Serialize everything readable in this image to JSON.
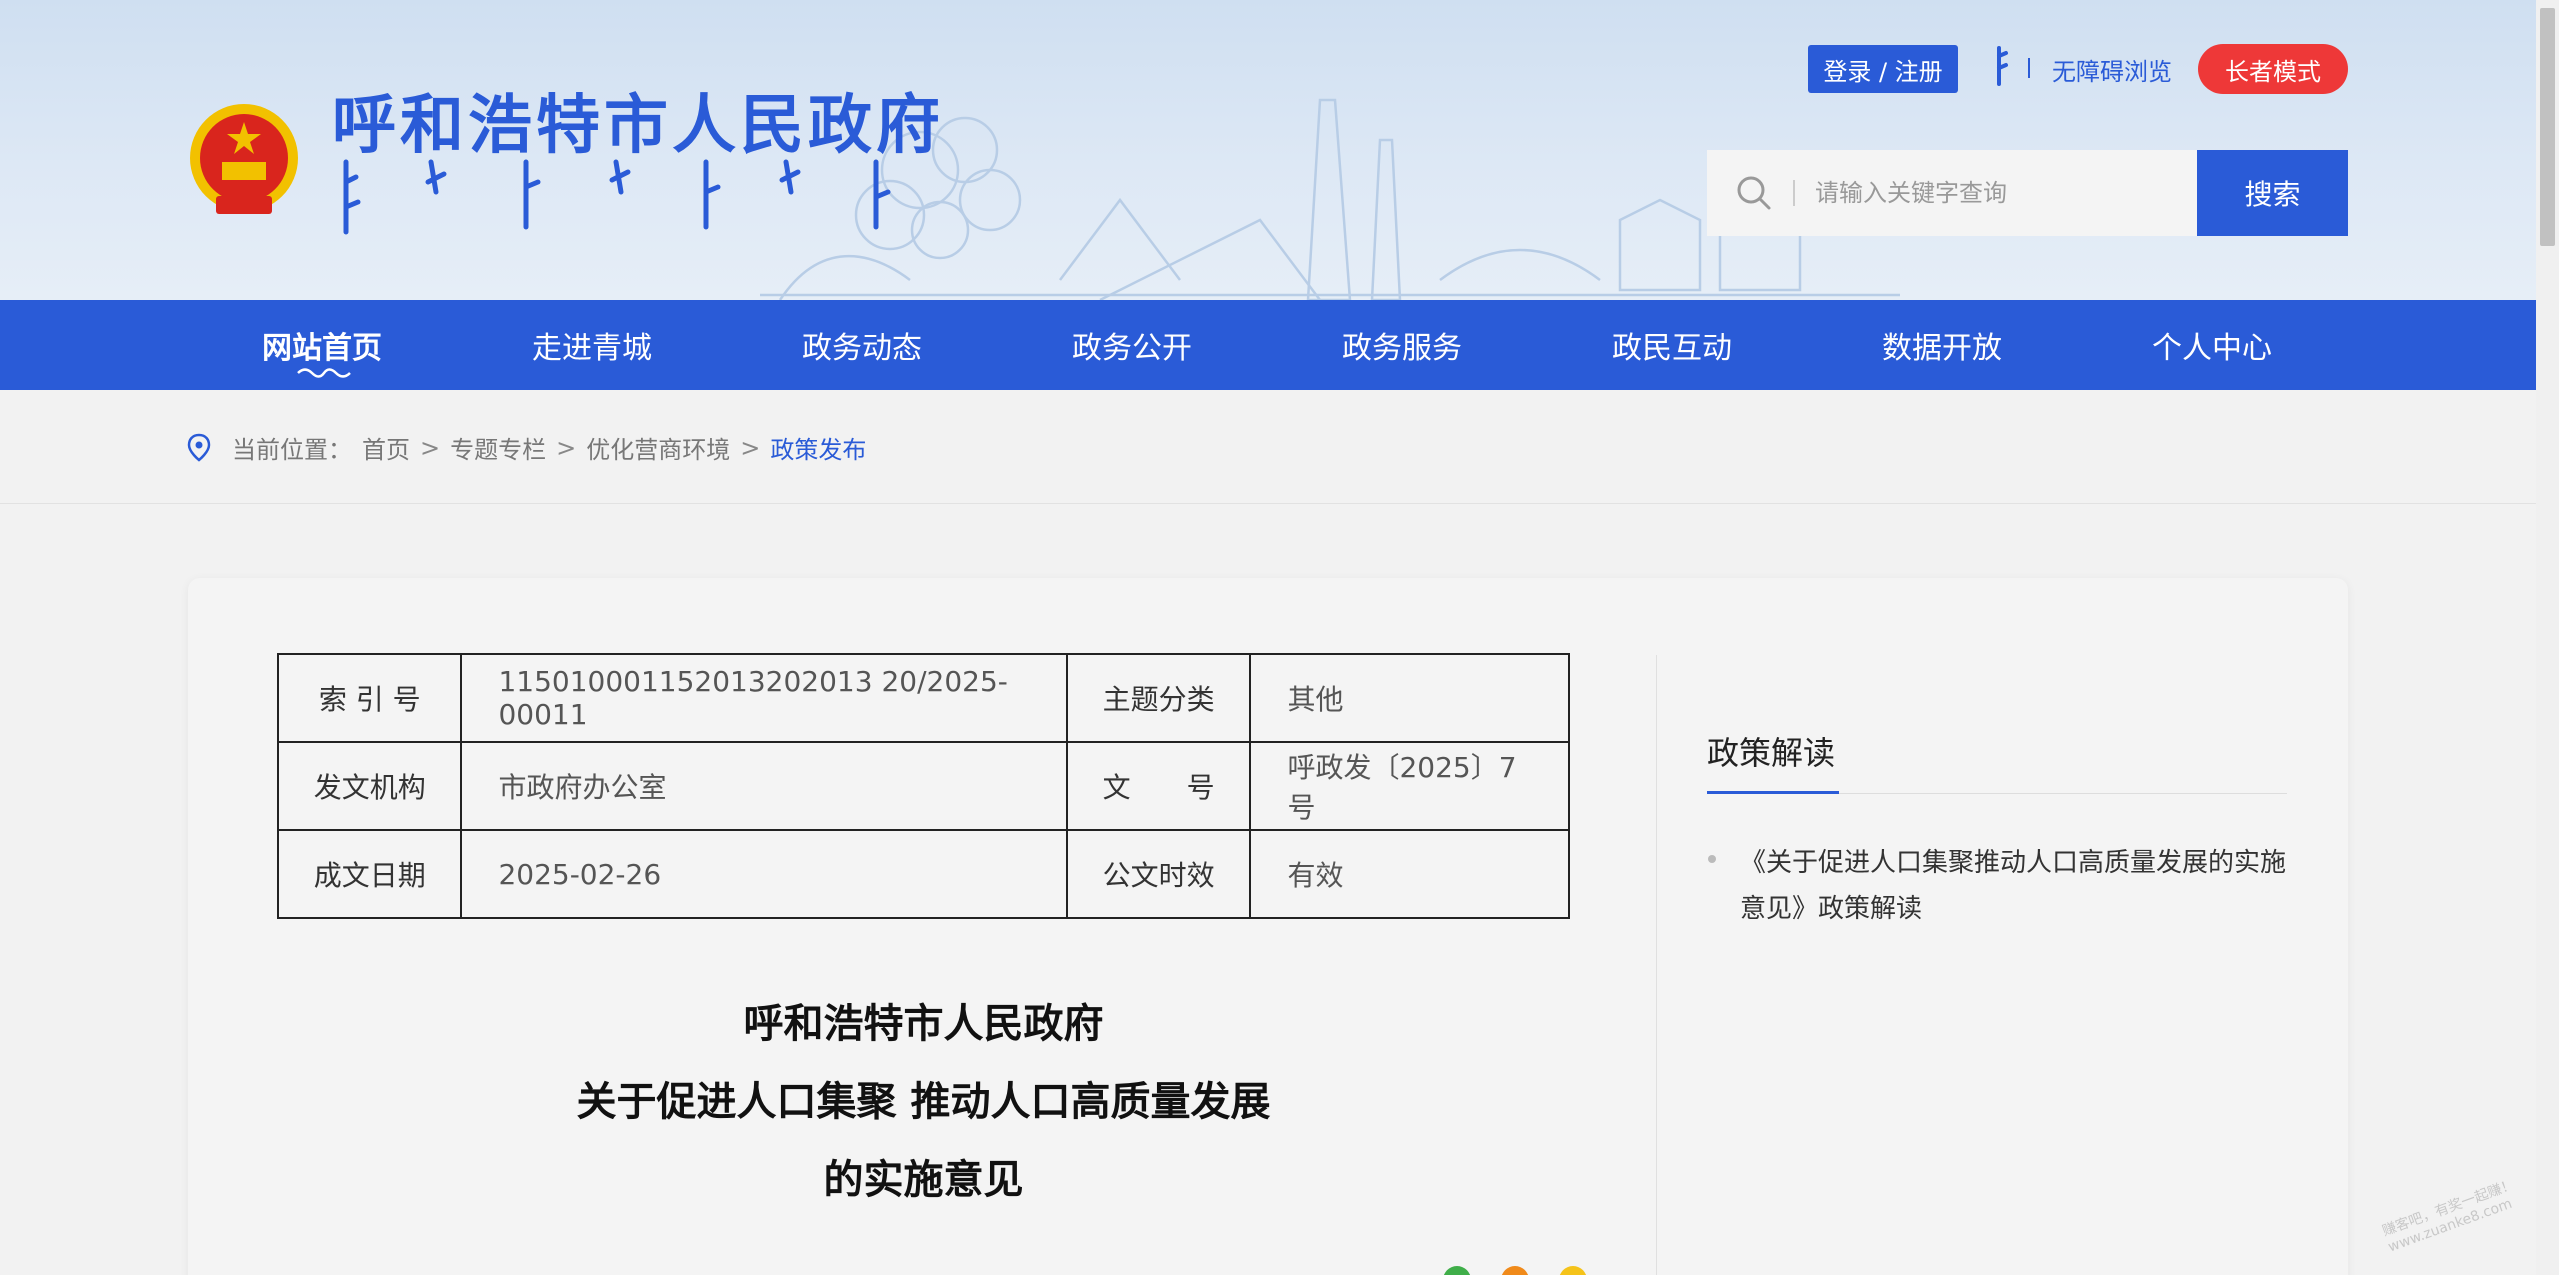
{
  "header": {
    "site_title": "呼和浩特市人民政府",
    "login_label": "登录 / 注册",
    "accessibility_label": "无障碍浏览",
    "elder_mode_label": "长者模式",
    "search_placeholder": "请输入关键字查询",
    "search_button": "搜索"
  },
  "nav": {
    "items": [
      {
        "label": "网站首页"
      },
      {
        "label": "走进青城"
      },
      {
        "label": "政务动态"
      },
      {
        "label": "政务公开"
      },
      {
        "label": "政务服务"
      },
      {
        "label": "政民互动"
      },
      {
        "label": "数据开放"
      },
      {
        "label": "个人中心"
      }
    ]
  },
  "breadcrumb": {
    "prefix": "当前位置：",
    "items": [
      "首页",
      "专题专栏",
      "优化营商环境",
      "政策发布"
    ],
    "separator": ">"
  },
  "meta_table": {
    "rows": [
      {
        "label1": "索 引 号",
        "value1": "115010001152013202013 20/2025-00011",
        "label2": "主题分类",
        "value2": "其他"
      },
      {
        "label1": "发文机构",
        "value1": "市政府办公室",
        "label2": "文　　号",
        "value2": "呼政发〔2025〕7号"
      },
      {
        "label1": "成文日期",
        "value1": "2025-02-26",
        "label2": "公文时效",
        "value2": "有效"
      }
    ]
  },
  "document": {
    "title_lines": [
      "呼和浩特市人民政府",
      "关于促进人口集聚 推动人口高质量发展",
      "的实施意见"
    ]
  },
  "sidebar": {
    "heading": "政策解读",
    "links": [
      "《关于促进人口集聚推动人口高质量发展的实施意见》政策解读"
    ]
  },
  "colors": {
    "primary": "#2a5bd7",
    "elder_red": "#ee3838",
    "header_bg": "#d6e4f3"
  },
  "watermark": "赚客吧，有奖一起赚！ www.zuanke8.com"
}
